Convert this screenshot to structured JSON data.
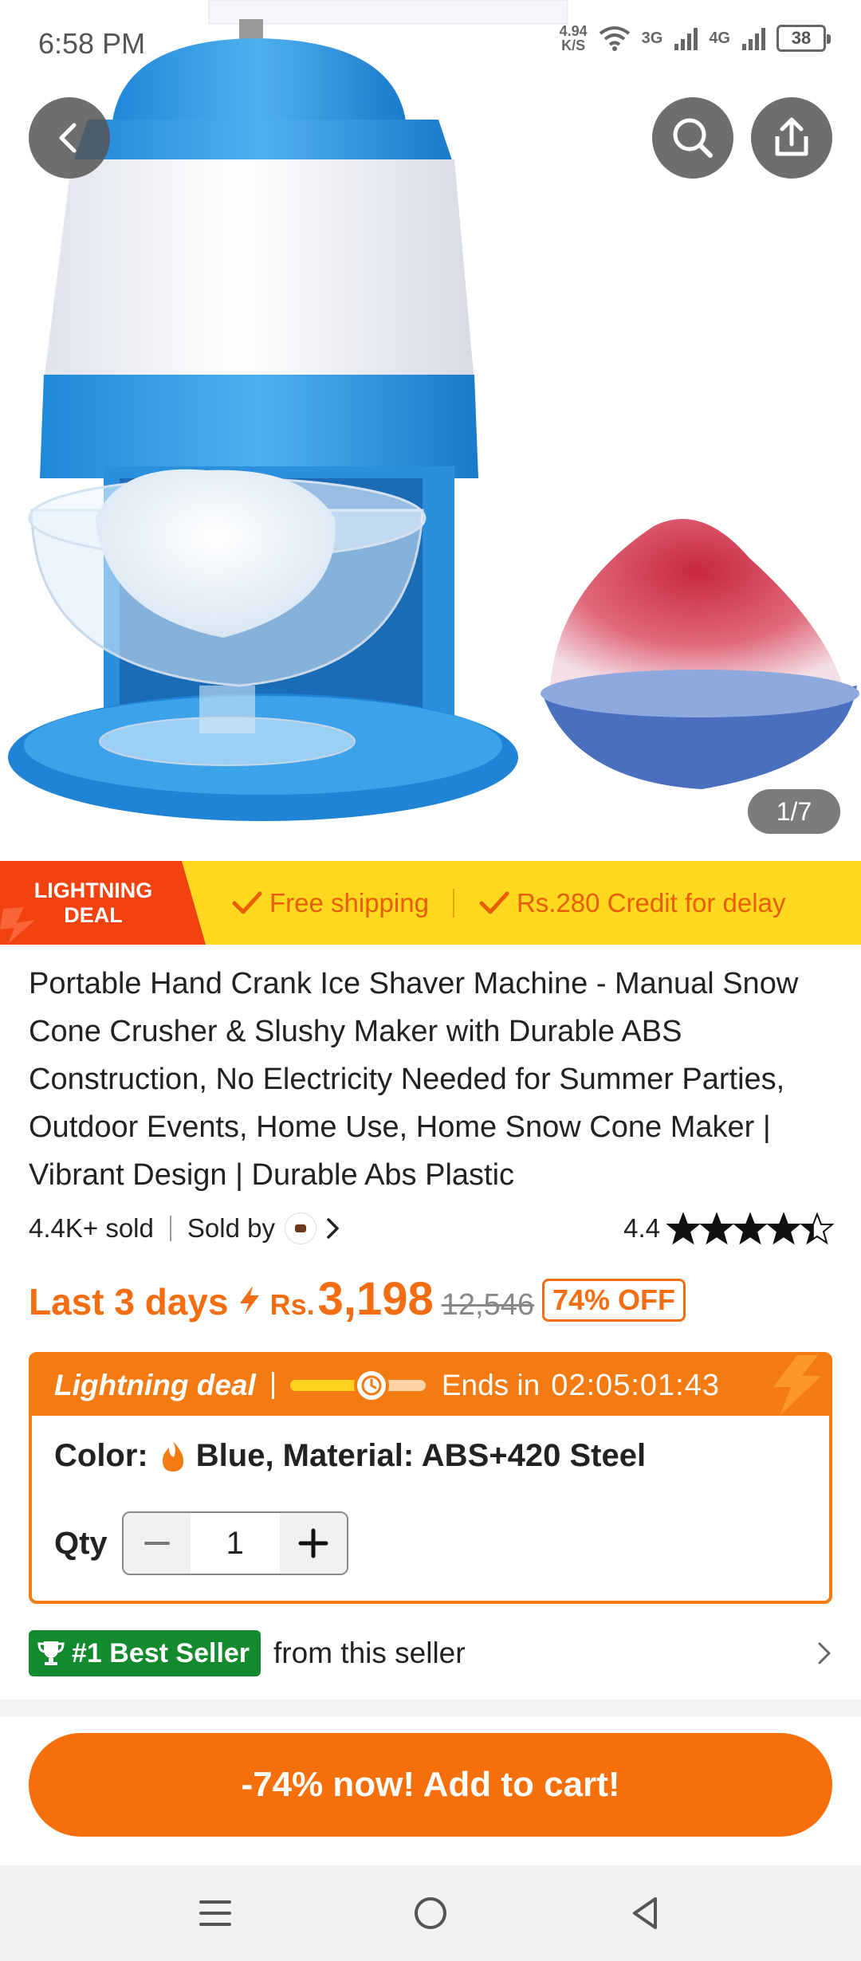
{
  "status_bar": {
    "time": "6:58 PM",
    "net_speed_value": "4.94",
    "net_speed_unit": "K/S",
    "signal_1": "3G",
    "signal_2": "4G",
    "battery": "38"
  },
  "gallery": {
    "page_indicator": "1/7",
    "icons": {
      "back": "chevron-left-icon",
      "search": "search-icon",
      "share": "share-icon"
    }
  },
  "deal_banner": {
    "tag_line1": "LIGHTNING",
    "tag_line2": "DEAL",
    "free_shipping": "Free shipping",
    "credit": "Rs.280 Credit for delay",
    "colors": {
      "banner_bg": "#ffd81f",
      "tag_bg": "#f2420f",
      "text": "#e85d00"
    }
  },
  "product": {
    "title": "Portable Hand Crank Ice Shaver Machine - Manual Snow Cone Crusher & Slushy Maker with Durable ABS Construction, No Electricity Needed for Summer Parties, Outdoor Events, Home Use, Home Snow Cone Maker | Vibrant Design | Durable Abs Plastic",
    "sold": "4.4K+ sold",
    "sold_by": "Sold by",
    "rating": "4.4",
    "rating_value": 4.4
  },
  "price": {
    "last_days": "Last 3 days",
    "currency": "Rs.",
    "current": "3,198",
    "original": "12,546",
    "discount": "74% OFF",
    "accent": "#f36d12"
  },
  "deal_box": {
    "label": "Lightning deal",
    "progress": 0.6,
    "ends_label": "Ends in",
    "countdown": "02:05:01:43",
    "color_label": "Color:",
    "color_value": "Blue, Material: ABS+420 Steel",
    "qty_label": "Qty",
    "qty_value": "1"
  },
  "best_seller": {
    "badge": "#1 Best Seller",
    "text": "from this seller",
    "badge_color": "#138a2e"
  },
  "cta": {
    "add_to_cart": "-74% now! Add to cart!",
    "color": "#f56f0b"
  }
}
